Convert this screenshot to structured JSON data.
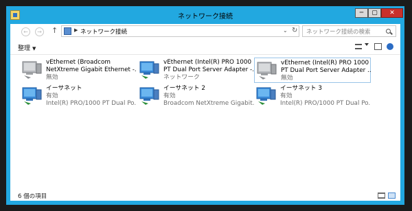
{
  "window": {
    "title": "ネットワーク接続",
    "close_glyph": "✕",
    "maximize_glyph": "▢",
    "minimize_glyph": "─"
  },
  "address": {
    "path": "ネットワーク接続",
    "search_placeholder": "ネットワーク接続の検索",
    "back_glyph": "←",
    "forward_glyph": "→",
    "up_glyph": "↑",
    "separator_glyph": "▶",
    "dropdown_glyph": "⌄",
    "refresh_glyph": "↻"
  },
  "toolbar": {
    "organize_label": "整理",
    "organize_caret": "▼"
  },
  "items": [
    {
      "name": "vEthernet (Broadcom",
      "line2": "NetXtreme Gigabit Ethernet -...",
      "line3": "無効",
      "state": "disabled"
    },
    {
      "name": "vEthernet (Intel(R) PRO 1000",
      "line2": "PT Dual Port Server Adapter -...",
      "line3": "ネットワーク",
      "state": "enabled"
    },
    {
      "name": "vEthernet (Intel(R) PRO 1000",
      "line2": "PT Dual Port Server Adapter ...",
      "line3": "無効",
      "state": "disabled",
      "selected": true
    },
    {
      "name": "イーサネット",
      "line2": "有効",
      "line3": "Intel(R) PRO/1000 PT Dual Po...",
      "state": "enabled"
    },
    {
      "name": "イーサネット 2",
      "line2": "有効",
      "line3": "Broadcom NetXtreme Gigabit...",
      "state": "enabled"
    },
    {
      "name": "イーサネット 3",
      "line2": "有効",
      "line3": "Intel(R) PRO/1000 PT Dual Po...",
      "state": "enabled"
    }
  ],
  "status": {
    "count_text": "6 個の項目"
  },
  "colors": {
    "accent_frame": "#22a8e0",
    "close_button": "#c9302c",
    "selection_border": "#99c4e8",
    "secondary_text": "#6d6d6d"
  }
}
